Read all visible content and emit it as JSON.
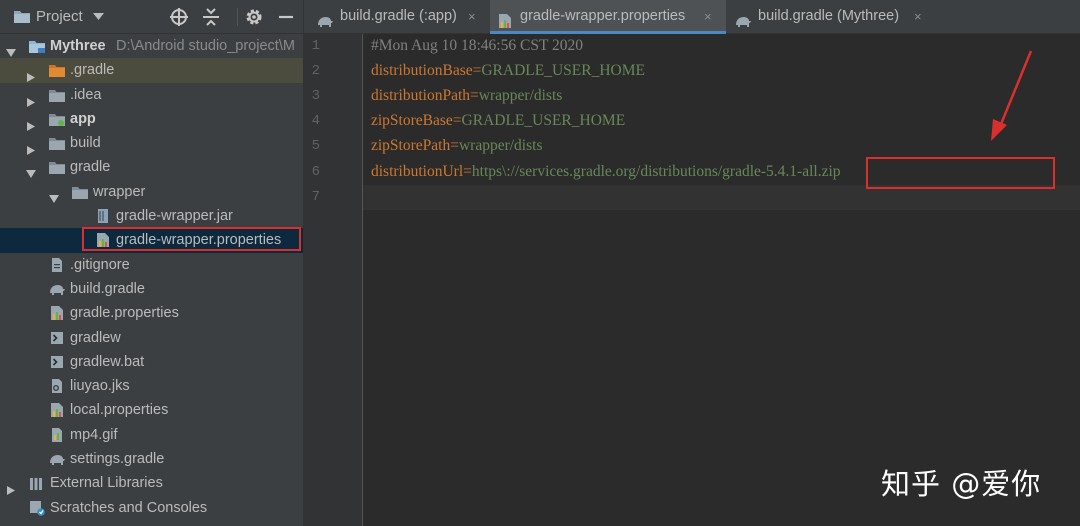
{
  "panel": {
    "title": "Project",
    "tree": [
      {
        "label": "Mythree",
        "path": "D:\\Android studio_project\\M",
        "icon": "module-folder-icon",
        "expanded": true,
        "bold": true
      },
      {
        "label": ".gradle",
        "icon": "orange-folder-icon",
        "expanded": false,
        "highlighted": true
      },
      {
        "label": ".idea",
        "icon": "folder-icon",
        "expanded": false
      },
      {
        "label": "app",
        "icon": "app-module-icon",
        "expanded": false,
        "bold": true
      },
      {
        "label": "build",
        "icon": "folder-icon",
        "expanded": false
      },
      {
        "label": "gradle",
        "icon": "folder-icon",
        "expanded": true
      },
      {
        "label": "wrapper",
        "icon": "folder-icon",
        "expanded": true
      },
      {
        "label": "gradle-wrapper.jar",
        "icon": "jar-file-icon"
      },
      {
        "label": "gradle-wrapper.properties",
        "icon": "properties-file-icon",
        "selected": true
      },
      {
        "label": ".gitignore",
        "icon": "text-file-icon"
      },
      {
        "label": "build.gradle",
        "icon": "gradle-elephant-icon"
      },
      {
        "label": "gradle.properties",
        "icon": "properties-file-icon"
      },
      {
        "label": "gradlew",
        "icon": "shell-file-icon"
      },
      {
        "label": "gradlew.bat",
        "icon": "shell-file-icon"
      },
      {
        "label": "liuyao.jks",
        "icon": "keystore-file-icon"
      },
      {
        "label": "local.properties",
        "icon": "properties-file-icon"
      },
      {
        "label": "mp4.gif",
        "icon": "image-file-icon"
      },
      {
        "label": "settings.gradle",
        "icon": "gradle-elephant-icon"
      },
      {
        "label": "External Libraries",
        "icon": "libraries-icon",
        "expanded": false
      },
      {
        "label": "Scratches and Consoles",
        "icon": "scratches-icon"
      }
    ]
  },
  "tabs": [
    {
      "label": "build.gradle (:app)",
      "icon": "gradle-elephant-icon",
      "active": false
    },
    {
      "label": "gradle-wrapper.properties",
      "icon": "properties-file-icon",
      "active": true
    },
    {
      "label": "build.gradle (Mythree)",
      "icon": "gradle-elephant-icon",
      "active": false
    }
  ],
  "tab_close_glyph": "×",
  "editor": {
    "line_numbers": [
      "1",
      "2",
      "3",
      "4",
      "5",
      "6",
      "7"
    ],
    "lines": [
      {
        "comment": "#Mon Aug 10 18:46:56 CST 2020"
      },
      {
        "key": "distributionBase",
        "eq": "=",
        "value": "GRADLE_USER_HOME"
      },
      {
        "key": "distributionPath",
        "eq": "=",
        "value": "wrapper/dists"
      },
      {
        "key": "zipStoreBase",
        "eq": "=",
        "value": "GRADLE_USER_HOME"
      },
      {
        "key": "zipStorePath",
        "eq": "=",
        "value": "wrapper/dists"
      },
      {
        "key": "distributionUrl",
        "eq": "=",
        "value": "https\\://services.gradle.org/distributions/gradle-5.4.1-all.zip"
      },
      {
        "comment": ""
      }
    ],
    "current_line": "7"
  },
  "watermark": "知乎 @爱你",
  "colors": {
    "panel_bg": "#3c3f41",
    "editor_bg": "#2b2b2b",
    "selection": "#0d293e",
    "annotation_red": "#d9302e",
    "key_orange": "#cc7832",
    "value_green": "#6a8759",
    "tab_accent": "#4a88c7"
  }
}
